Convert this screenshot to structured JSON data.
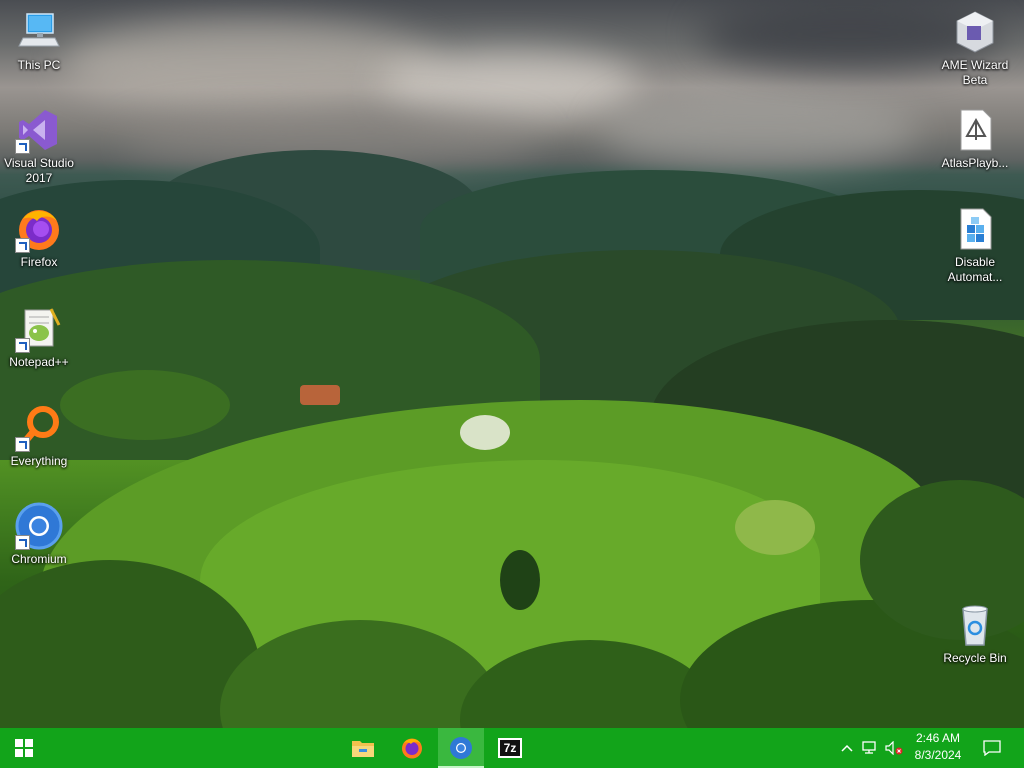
{
  "desktop": {
    "icons_left": [
      {
        "label": "This PC",
        "icon": "monitor-icon"
      },
      {
        "label": "Visual Studio 2017",
        "icon": "visual-studio-icon"
      },
      {
        "label": "Firefox",
        "icon": "firefox-icon"
      },
      {
        "label": "Notepad++",
        "icon": "notepadpp-icon"
      },
      {
        "label": "Everything",
        "icon": "everything-search-icon"
      },
      {
        "label": "Chromium",
        "icon": "chromium-icon"
      }
    ],
    "icons_right": [
      {
        "label": "AME Wizard Beta",
        "icon": "ame-wizard-icon"
      },
      {
        "label": "AtlasPlayb...",
        "icon": "atlas-playbook-icon"
      },
      {
        "label": "Disable Automat...",
        "icon": "disable-automation-icon"
      },
      {
        "label": "Recycle Bin",
        "icon": "recycle-bin-icon"
      }
    ]
  },
  "taskbar": {
    "start_icon": "windows-logo-icon",
    "pinned": [
      {
        "name": "File Explorer",
        "icon": "file-explorer-icon"
      },
      {
        "name": "Firefox",
        "icon": "firefox-icon"
      },
      {
        "name": "Chromium",
        "icon": "chromium-icon"
      },
      {
        "name": "7-Zip",
        "icon": "seven-zip-icon"
      }
    ],
    "seven_zip_text": "7z",
    "clock_time": "2:46 AM",
    "clock_date": "8/3/2024",
    "colors": {
      "taskbar": "#12a41a",
      "active": "#3ab83f"
    }
  }
}
